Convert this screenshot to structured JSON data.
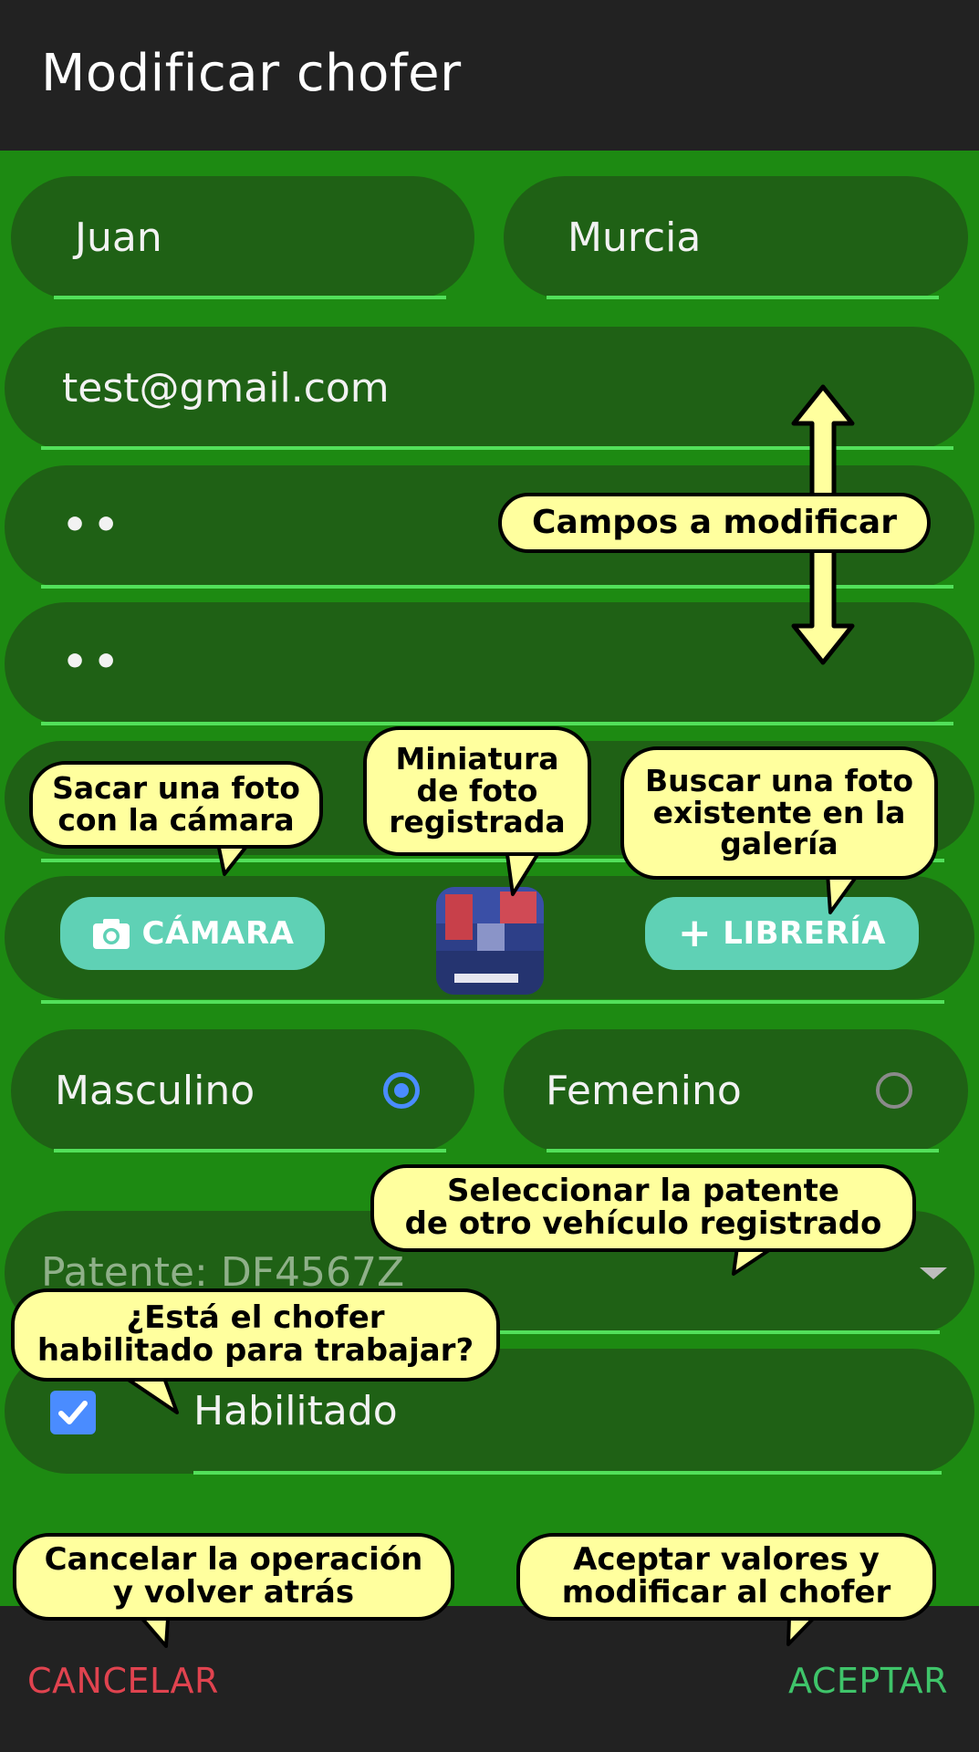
{
  "header": {
    "title": "Modificar chofer"
  },
  "form": {
    "first_name": "Juan",
    "last_name": "Murcia",
    "email": "test@gmail.com",
    "password": "••",
    "password_confirm": "••",
    "camera_label": "CÁMARA",
    "library_label": "LIBRERÍA",
    "gender_male": "Masculino",
    "gender_female": "Femenino",
    "gender_selected": "Masculino",
    "plate_label": "Patente: DF4567Z",
    "enabled_label": "Habilitado",
    "enabled_checked": true
  },
  "footer": {
    "cancel_label": "CANCELAR",
    "accept_label": "ACEPTAR"
  },
  "annotations": {
    "fields": "Campos a modificar",
    "camera": "Sacar una foto\ncon la cámara",
    "thumbnail": "Miniatura\nde foto\nregistrada",
    "library": "Buscar una foto\nexistente en la\ngalería",
    "plate": "Seleccionar la patente\nde otro vehículo registrado",
    "enabled": "¿Está el chofer\nhabilitado para trabajar?",
    "cancel": "Cancelar la operación\ny volver atrás",
    "accept": "Aceptar valores y\nmodificar al chofer"
  },
  "colors": {
    "accent_green": "#52e05a",
    "button_teal": "#5fd1b5",
    "radio_blue": "#4a8cff",
    "cancel_red": "#e0434f",
    "accept_green": "#3fc46a",
    "callout_yellow": "#ffff9e"
  }
}
